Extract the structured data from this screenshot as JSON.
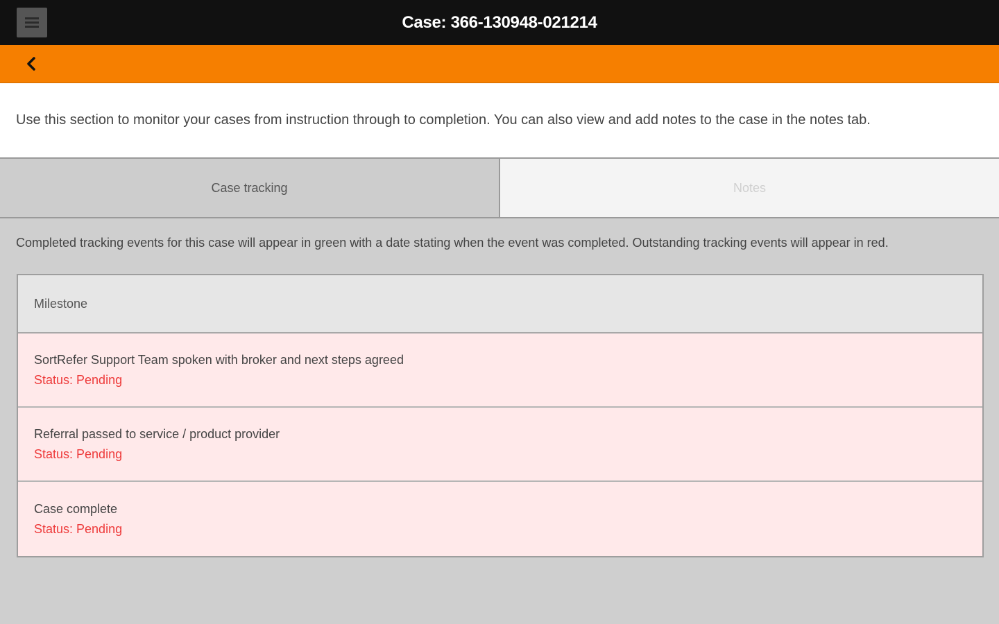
{
  "header": {
    "title": "Case: 366-130948-021214",
    "menu_icon": "hamburger-menu-icon",
    "back_icon": "chevron-left-icon"
  },
  "intro_text": "Use this section to monitor your cases from instruction through to completion. You can also view and add notes to the case in the notes tab.",
  "tabs": [
    {
      "label": "Case tracking",
      "active": true
    },
    {
      "label": "Notes",
      "active": false
    }
  ],
  "helper_text": "Completed tracking events for this case will appear in green with a date stating when the event was completed. Outstanding tracking events will appear in red.",
  "table": {
    "header": "Milestone",
    "rows": [
      {
        "name": "SortRefer Support Team spoken with broker and next steps agreed",
        "status": "Status: Pending"
      },
      {
        "name": "Referral passed to service / product provider",
        "status": "Status: Pending"
      },
      {
        "name": "Case complete",
        "status": "Status: Pending"
      }
    ]
  },
  "colors": {
    "topbar": "#111111",
    "accent": "#f67f00",
    "pending_text": "#ee3a3a",
    "pending_row_bg": "#ffe9ea"
  }
}
